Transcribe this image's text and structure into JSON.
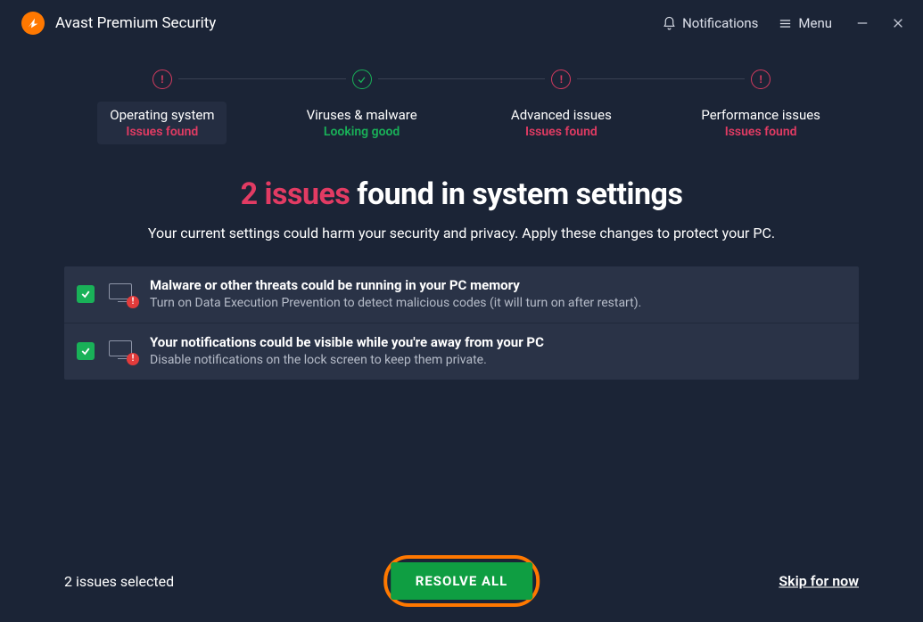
{
  "app": {
    "title": "Avast Premium Security"
  },
  "header": {
    "notifications": "Notifications",
    "menu": "Menu"
  },
  "stepper": [
    {
      "name": "Operating system",
      "status": "Issues found",
      "state": "bad",
      "active": true
    },
    {
      "name": "Viruses & malware",
      "status": "Looking good",
      "state": "good",
      "active": false
    },
    {
      "name": "Advanced issues",
      "status": "Issues found",
      "state": "bad",
      "active": false
    },
    {
      "name": "Performance issues",
      "status": "Issues found",
      "state": "bad",
      "active": false
    }
  ],
  "headline": {
    "count_text": "2 issues",
    "rest": " found in system settings"
  },
  "sub": "Your current settings could harm your security and privacy. Apply these changes to protect your PC.",
  "issues": [
    {
      "title": "Malware or other threats could be running in your PC memory",
      "desc": "Turn on Data Execution Prevention to detect malicious codes (it will turn on after restart).",
      "checked": true
    },
    {
      "title": "Your notifications could be visible while you're away from your PC",
      "desc": "Disable notifications on the lock screen to keep them private.",
      "checked": true
    }
  ],
  "footer": {
    "selected": "2 issues selected",
    "resolve": "RESOLVE ALL",
    "skip": "Skip for now"
  }
}
